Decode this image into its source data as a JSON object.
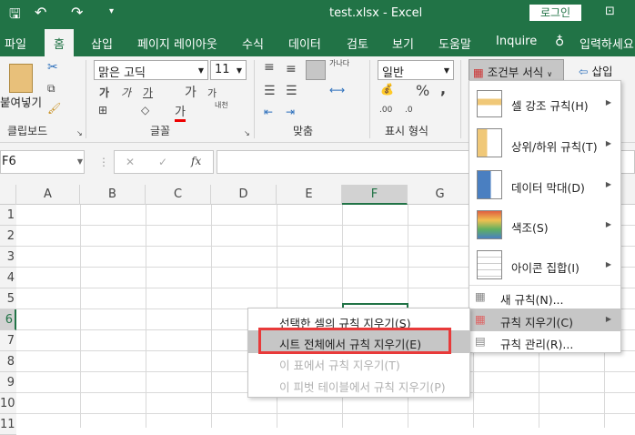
{
  "title": "test.xlsx  -  Excel",
  "login": "로그인",
  "tabs": [
    "파일",
    "홈",
    "삽입",
    "페이지 레이아웃",
    "수식",
    "데이터",
    "검토",
    "보기",
    "도움말",
    "Inquire",
    "입력하세요"
  ],
  "ribbon": {
    "clipboard": {
      "paste": "붙여넣기",
      "group": "클립보드"
    },
    "font": {
      "name": "맑은 고딕",
      "size": "11",
      "bold": "가",
      "italic": "가",
      "underline": "가",
      "grow": "가",
      "shrink": "가",
      "color": "가",
      "phonetic": "내천",
      "group": "글꼴"
    },
    "align": {
      "wrap": "가나다",
      "group": "맞춤"
    },
    "number": {
      "format": "일반",
      "percent": "%",
      "comma": ",",
      "inc": ".00",
      "dec": ".0",
      "group": "표시 형식"
    },
    "cond_format": "조건부 서식",
    "insert": "삽입"
  },
  "formula_bar": {
    "name_box": "F6",
    "fx": "fx",
    "cancel": "✕",
    "enter": "✓"
  },
  "columns": [
    "A",
    "B",
    "C",
    "D",
    "E",
    "F",
    "G"
  ],
  "rows": [
    "1",
    "2",
    "3",
    "4",
    "5",
    "6",
    "7",
    "8",
    "9",
    "10",
    "11"
  ],
  "cf_menu": [
    {
      "label": "셀 강조 규칙(H)",
      "sub": true
    },
    {
      "label": "상위/하위 규칙(T)",
      "sub": true
    },
    {
      "label": "데이터 막대(D)",
      "sub": true
    },
    {
      "label": "색조(S)",
      "sub": true
    },
    {
      "label": "아이콘 집합(I)",
      "sub": true
    },
    {
      "label": "새 규칙(N)..."
    },
    {
      "label": "규칙 지우기(C)",
      "sub": true
    },
    {
      "label": "규칙 관리(R)..."
    }
  ],
  "clear_menu": [
    "선택한 셀의 규칙 지우기(S)",
    "시트 전체에서 규칙 지우기(E)",
    "이 표에서 규칙 지우기(T)",
    "이 피벗 테이블에서 규칙 지우기(P)"
  ],
  "colors": {
    "accent": "#217346",
    "highlight": "#e83a3a"
  }
}
